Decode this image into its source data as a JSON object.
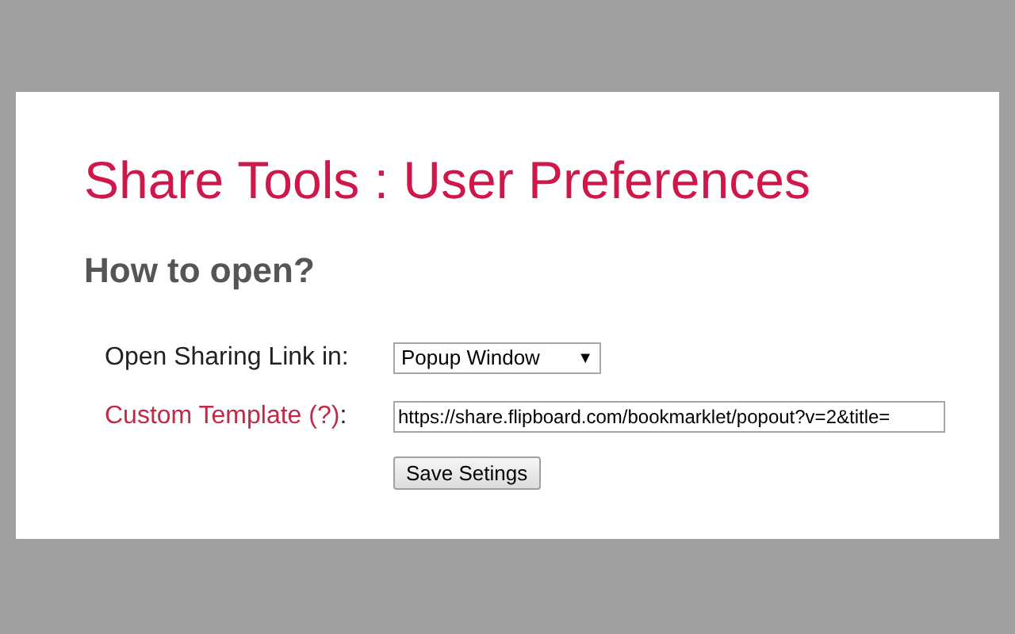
{
  "page": {
    "title": "Share Tools : User Preferences"
  },
  "section": {
    "heading": "How to open?"
  },
  "open_in": {
    "label": "Open Sharing Link in:",
    "value": "Popup Window",
    "caret": "▼"
  },
  "custom_template": {
    "link": "Custom Template (?)",
    "colon": ":",
    "value": "https://share.flipboard.com/bookmarklet/popout?v=2&title="
  },
  "save_button": {
    "label": "Save Setings"
  }
}
